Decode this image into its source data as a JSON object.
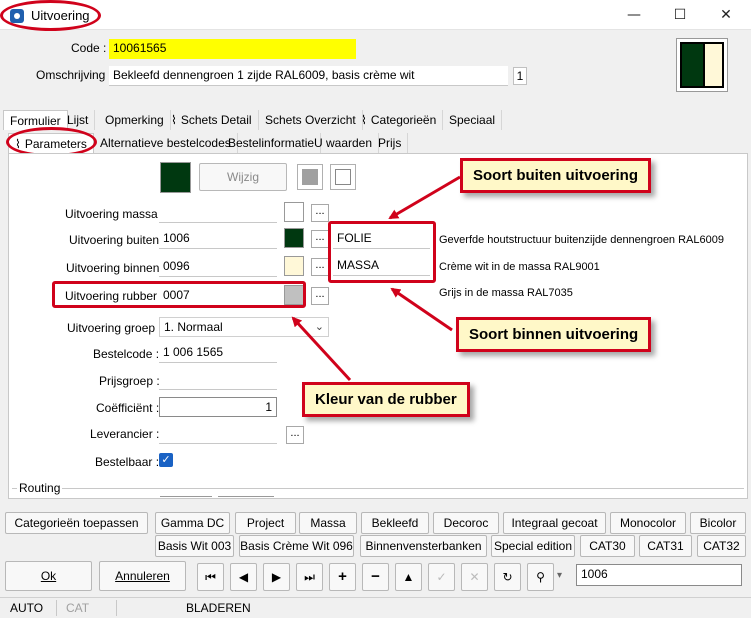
{
  "window": {
    "title": "Uitvoering",
    "minimize": "—",
    "maximize": "☐",
    "close": "✕"
  },
  "header": {
    "code_label": "Code :",
    "code_value": "10061565",
    "omschrijving_label": "Omschrijving :",
    "omschrijving_value": "Bekleefd dennengroen 1 zijde RAL6009, basis crème wit",
    "omschrijving_count": "1"
  },
  "tabs_top": [
    "Formulier",
    "Lijst",
    "Opmerking",
    "Schets Detail",
    "Schets Overzicht",
    "Categorieën",
    "Speciaal"
  ],
  "tabs_sub": [
    "Parameters",
    "Alternatieve bestelcodes",
    "Bestelinformatie",
    "U waarden",
    "Prijs"
  ],
  "panel": {
    "wijzig": "Wijzig",
    "fields": [
      {
        "label": "Uitvoering massa :",
        "value": ""
      },
      {
        "label": "Uitvoering buiten:",
        "value": "1006",
        "kind": "FOLIE",
        "desc": "Geverfde houtstructuur buitenzijde dennengroen RAL6009"
      },
      {
        "label": "Uitvoering binnen:",
        "value": "0096",
        "kind": "MASSA",
        "desc": "Crème wit in de massa RAL9001"
      },
      {
        "label": "Uitvoering rubber :",
        "value": "0007",
        "desc": "Grijs in de massa RAL7035"
      },
      {
        "label": "Uitvoering groep :",
        "value": "1.  Normaal"
      },
      {
        "label": "Bestelcode :",
        "value": "1 006 1565"
      },
      {
        "label": "Prijsgroep :",
        "value": ""
      },
      {
        "label": "Coëfficiënt :",
        "value": "1"
      },
      {
        "label": "Leverancier :",
        "value": ""
      },
      {
        "label": "Bestelbaar :",
        "value": "✓"
      }
    ],
    "routing": "Routing"
  },
  "callouts": {
    "buiten": "Soort buiten uitvoering",
    "binnen": "Soort binnen uitvoering",
    "rubber": "Kleur van de rubber"
  },
  "category_buttons_row1": [
    "Categorieën toepassen",
    "Gamma DC",
    "Project",
    "Massa",
    "Bekleefd",
    "Decoroc",
    "Integraal gecoat",
    "Monocolor",
    "Bicolor"
  ],
  "category_buttons_row2": [
    "Basis Wit 003",
    "Basis Crème Wit 096",
    "Binnenvensterbanken",
    "Special edition",
    "CAT30",
    "CAT31",
    "CAT32"
  ],
  "bottom": {
    "ok": "Ok",
    "annuleren": "Annuleren",
    "search_value": "1006",
    "nav_icons": [
      "first-icon",
      "prev-icon",
      "next-icon",
      "last-icon",
      "add-icon",
      "remove-icon",
      "up-icon",
      "confirm-icon",
      "cancel-icon",
      "refresh-icon",
      "binoculars-icon",
      "dropdown-icon"
    ]
  },
  "status": {
    "auto": "AUTO",
    "cat": "CAT",
    "mode": "BLADEREN"
  },
  "colors": {
    "accent": "#d0021b",
    "dennengroen": "#003810",
    "creme": "#fff8d8",
    "grijs": "#c0c0c0",
    "yellow": "#ffff00"
  }
}
